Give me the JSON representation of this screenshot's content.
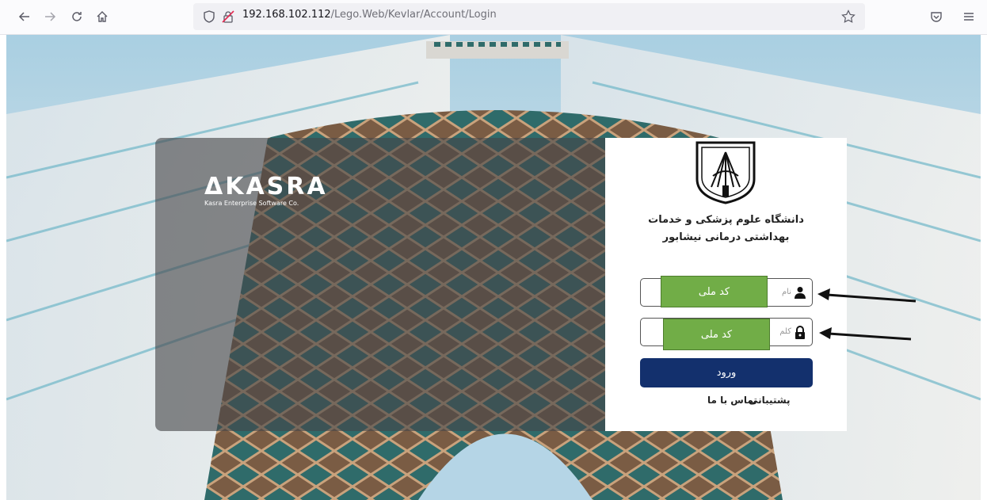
{
  "browser": {
    "url_host": "192.168.102.112",
    "url_path": "/Lego.Web/Kevlar/Account/Login",
    "icons": [
      "back-icon",
      "forward-icon",
      "reload-icon",
      "home-icon",
      "shield-icon",
      "insecure-lock-icon",
      "bookmark-star-icon",
      "pocket-icon",
      "menu-icon"
    ]
  },
  "brand": {
    "name": "ΔKASRA",
    "subtitle": "Kasra  Enterprise Software Co."
  },
  "university": {
    "line1": "دانشگاه علوم پزشکی و خدمات",
    "line2": "بهداشتی درمانی نیشابور"
  },
  "form": {
    "username_placeholder": "نام",
    "password_placeholder": "کلم",
    "username_overlay": "کد ملی",
    "password_overlay": "کد ملی",
    "submit_label": "ورود"
  },
  "links": {
    "support": "پشتیبانی",
    "contact": "تماس با ما"
  },
  "colors": {
    "submit_button": "#13306d",
    "overlay_green": "#71ad47"
  }
}
